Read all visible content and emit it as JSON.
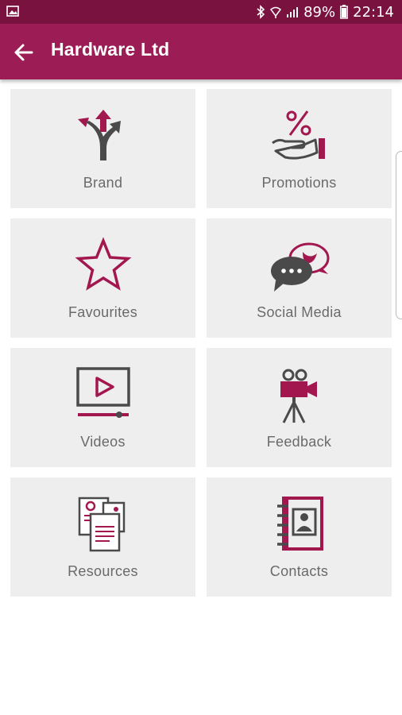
{
  "status": {
    "battery": "89%",
    "time": "22:14"
  },
  "app_bar": {
    "title": "Hardware Ltd"
  },
  "tiles": [
    {
      "label": "Brand",
      "icon": "directions-arrows-icon"
    },
    {
      "label": "Promotions",
      "icon": "percent-hand-icon"
    },
    {
      "label": "Favourites",
      "icon": "star-icon"
    },
    {
      "label": "Social Media",
      "icon": "social-chat-bird-icon"
    },
    {
      "label": "Videos",
      "icon": "video-player-icon"
    },
    {
      "label": "Feedback",
      "icon": "movie-camera-icon"
    },
    {
      "label": "Resources",
      "icon": "documents-icon"
    },
    {
      "label": "Contacts",
      "icon": "address-book-icon"
    }
  ],
  "colors": {
    "status_bar": "#7a1240",
    "app_bar": "#9c1c55",
    "accent": "#a3174f",
    "icon_gray": "#4a4a4a",
    "tile_bg": "#eeeeee"
  }
}
